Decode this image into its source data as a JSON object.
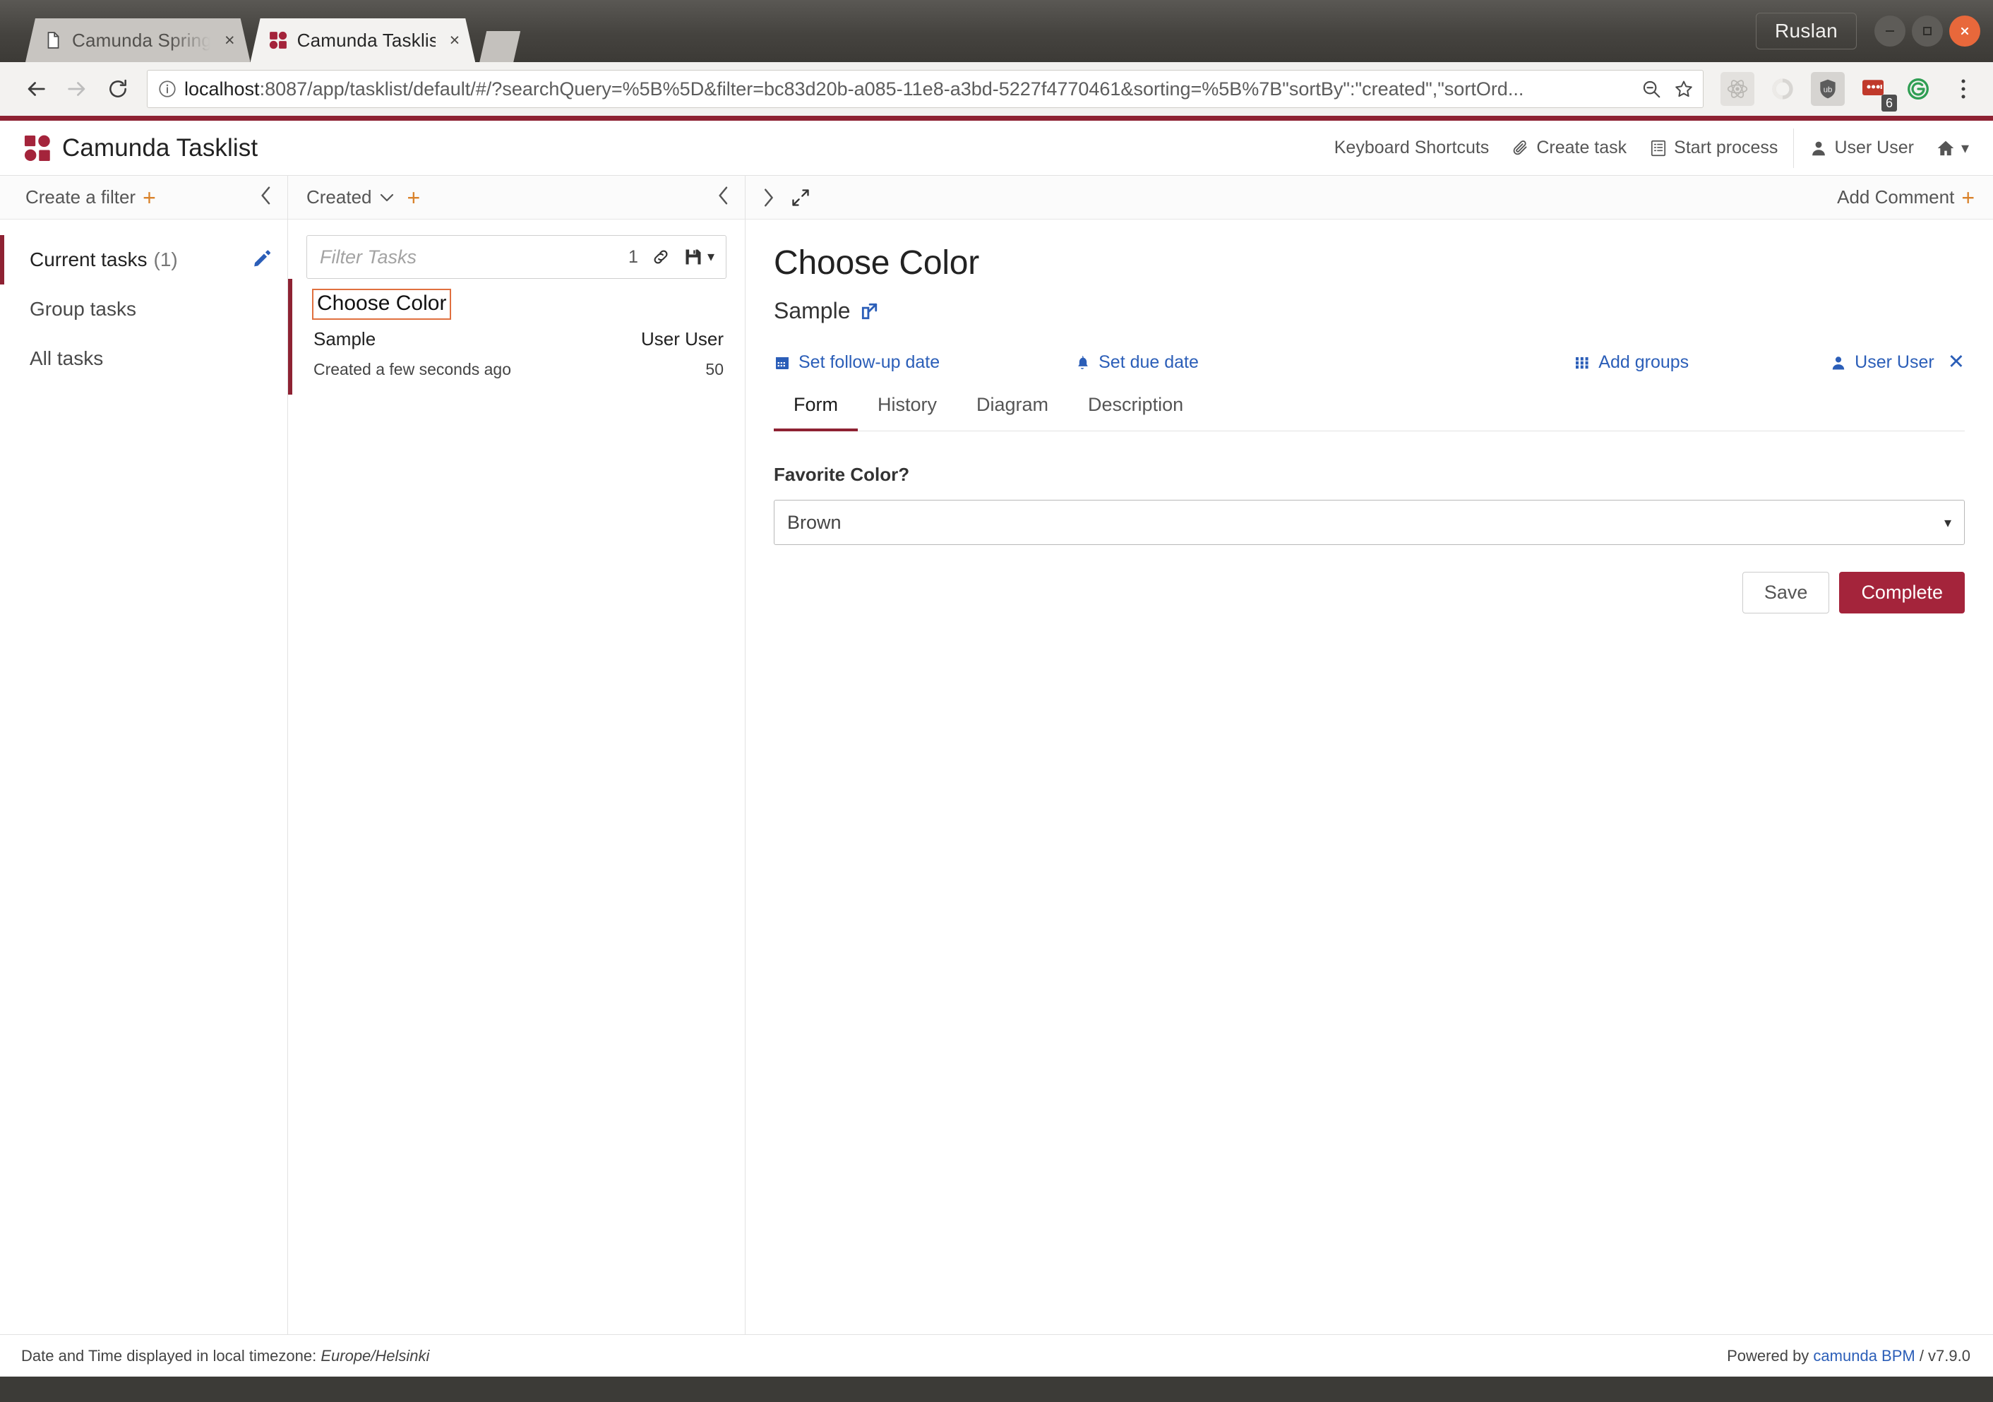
{
  "window": {
    "profile_label": "Ruslan",
    "minimize_icon": "minimize-icon",
    "maximize_icon": "maximize-icon",
    "close_icon": "close-icon"
  },
  "browser": {
    "tabs": [
      {
        "title": "Camunda Spring Bo",
        "favicon": "page-icon",
        "active": false
      },
      {
        "title": "Camunda Tasklist",
        "favicon": "camunda-icon",
        "active": true
      }
    ],
    "close_label": "×",
    "back_icon": "back-arrow-icon",
    "forward_icon": "forward-arrow-icon",
    "reload_icon": "reload-icon",
    "url_host": "localhost",
    "url_rest": ":8087/app/tasklist/default/#/?searchQuery=%5B%5D&filter=bc83d20b-a085-11e8-a3bd-5227f4770461&sorting=%5B%7B\"sortBy\":\"created\",\"sortOrd...",
    "info_icon": "info-icon",
    "zoom_out_icon": "zoom-out-icon",
    "bookmark_icon": "star-icon",
    "extensions": [
      {
        "name": "react-devtools-icon",
        "badge": ""
      },
      {
        "name": "ring-extension-icon",
        "badge": ""
      },
      {
        "name": "ublock-origin-icon",
        "badge": ""
      },
      {
        "name": "red-extension-icon",
        "badge": "6"
      },
      {
        "name": "grammarly-icon",
        "badge": ""
      }
    ],
    "menu_icon": "three-dot-menu-icon"
  },
  "header": {
    "brand": "Camunda Tasklist",
    "logo_icon": "camunda-logo-icon",
    "nav": [
      {
        "label": "Keyboard Shortcuts",
        "icon": ""
      },
      {
        "label": "Create task",
        "icon": "paperclip-icon"
      },
      {
        "label": "Start process",
        "icon": "list-icon"
      }
    ],
    "user": {
      "label": "User User",
      "icon": "user-icon"
    },
    "home_icon": "home-icon",
    "home_caret": "▾"
  },
  "sidebar": {
    "head": {
      "label": "Create a filter",
      "plus": "+",
      "collapse_icon": "chevron-left-icon"
    },
    "items": [
      {
        "label": "Current tasks",
        "count": "(1)",
        "active": true,
        "edit_icon": "pencil-icon"
      },
      {
        "label": "Group tasks",
        "count": "",
        "active": false,
        "edit_icon": ""
      },
      {
        "label": "All tasks",
        "count": "",
        "active": false,
        "edit_icon": ""
      }
    ]
  },
  "tasklist": {
    "head": {
      "sort_label": "Created",
      "sort_caret": "⌄",
      "plus": "+",
      "collapse_icon": "chevron-left-icon"
    },
    "search": {
      "placeholder": "Filter Tasks",
      "value": "",
      "count": "1",
      "link_icon": "link-icon",
      "save_icon": "floppy-save-icon",
      "save_caret": "▾"
    },
    "tasks": [
      {
        "title": "Choose Color",
        "process": "Sample",
        "assignee": "User User",
        "created": "Created a few seconds ago",
        "priority": "50",
        "selected": true,
        "focused": true
      }
    ]
  },
  "detail": {
    "head": {
      "expand_right_icon": "chevron-right-icon",
      "fullscreen_icon": "expand-icon",
      "add_comment": "Add Comment",
      "add_comment_plus": "+"
    },
    "title": "Choose Color",
    "process": "Sample",
    "process_link_icon": "external-link-icon",
    "actions": [
      {
        "label": "Set follow-up date",
        "icon": "calendar-icon"
      },
      {
        "label": "Set due date",
        "icon": "bell-icon"
      },
      {
        "label": "Add groups",
        "icon": "grid-icon"
      }
    ],
    "assignee": {
      "label": "User User",
      "icon": "user-icon",
      "remove": "✕"
    },
    "tabs": [
      {
        "label": "Form",
        "active": true
      },
      {
        "label": "History",
        "active": false
      },
      {
        "label": "Diagram",
        "active": false
      },
      {
        "label": "Description",
        "active": false
      }
    ],
    "form": {
      "label": "Favorite Color?",
      "select_value": "Brown",
      "select_caret": "▾"
    },
    "buttons": {
      "save": "Save",
      "complete": "Complete"
    }
  },
  "footer": {
    "timezone_prefix": "Date and Time displayed in local timezone: ",
    "timezone": "Europe/Helsinki",
    "powered_prefix": "Powered by ",
    "powered_link": "camunda BPM",
    "powered_version": " / v7.9.0"
  },
  "colors": {
    "brand_red": "#8e2233",
    "complete_red": "#a4243b",
    "link_blue": "#2b5eb8",
    "accent_orange": "#d9822b",
    "focus_orange": "#e0703f"
  }
}
